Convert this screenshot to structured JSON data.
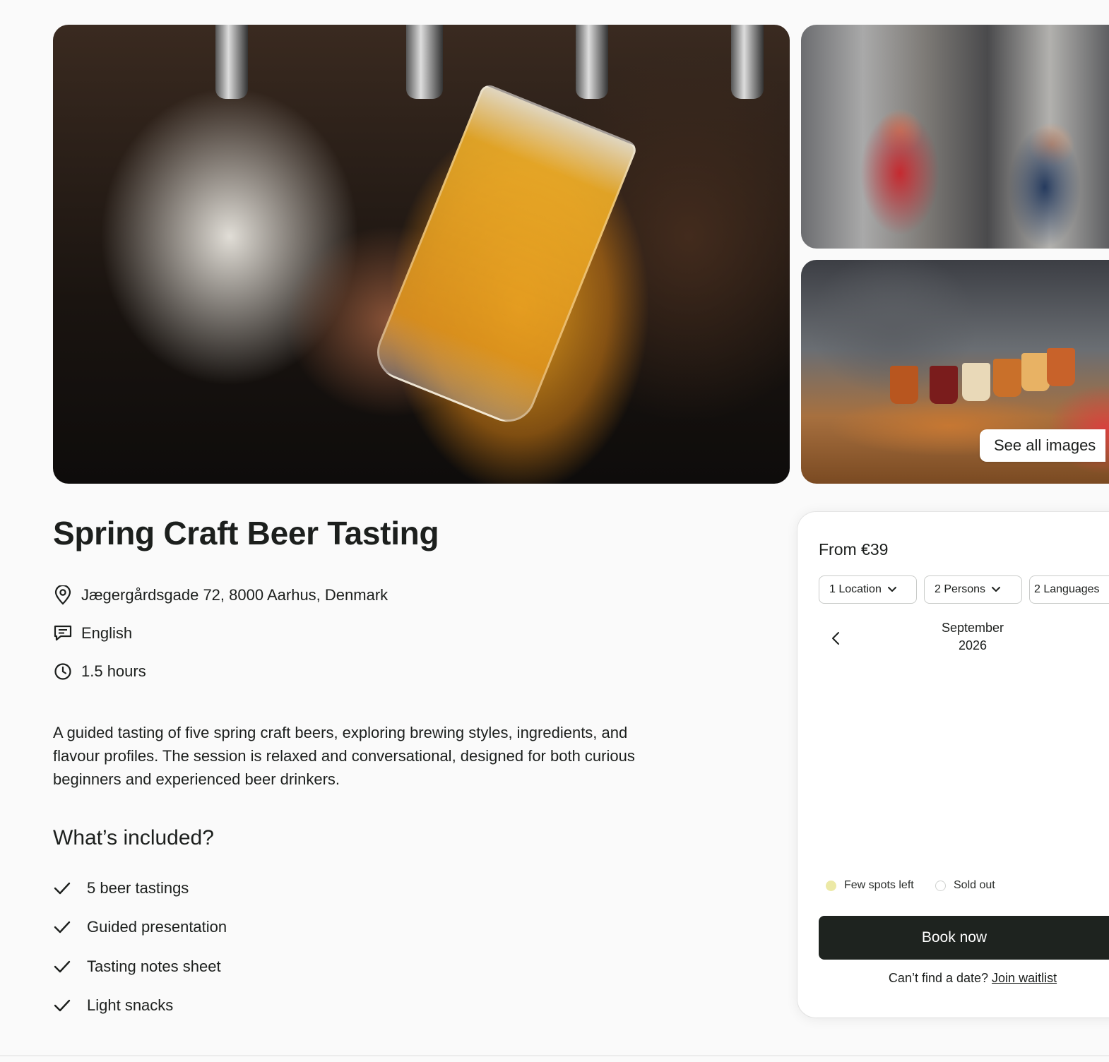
{
  "gallery": {
    "main_image": "beer-pour-photo",
    "side_image_1": "brewers-toasting-photo",
    "side_image_2": "tasting-flight-photo",
    "see_all_label": "See all images"
  },
  "event": {
    "title": "Spring Craft Beer Tasting",
    "location": "Jægergårdsgade 72, 8000 Aarhus, Denmark",
    "language": "English",
    "duration": "1.5 hours",
    "description": "A guided tasting of five spring craft beers, exploring brewing styles, ingredients, and flavour profiles. The session is relaxed and conversational, designed for both curious beginners and experienced beer drinkers.",
    "included_heading": "What’s included?",
    "included": [
      {
        "label": "5 beer tastings"
      },
      {
        "label": "Guided presentation"
      },
      {
        "label": "Tasting notes sheet"
      },
      {
        "label": "Light snacks"
      }
    ]
  },
  "booking": {
    "price_label": "From €39",
    "filters": [
      {
        "label": "1 Location"
      },
      {
        "label": "2 Persons"
      },
      {
        "label": "2 Languages"
      }
    ],
    "calendar": {
      "month": "September",
      "year": "2026"
    },
    "legend": {
      "few_spots": "Few spots left",
      "sold_out": "Sold out",
      "few_spots_color": "#ece9a6",
      "sold_out_color": "#ffffff"
    },
    "book_label": "Book now",
    "waitlist_prompt": "Can’t find a date?",
    "waitlist_link": "Join waitlist"
  },
  "colors": {
    "primary_button": "#1e231f",
    "background": "#fafafa",
    "text": "#1c1f1d"
  }
}
